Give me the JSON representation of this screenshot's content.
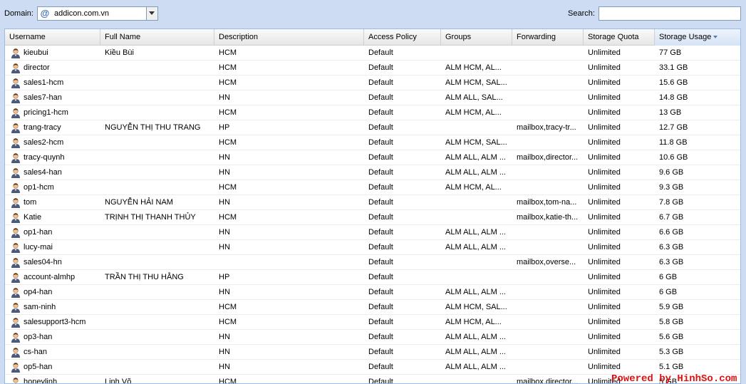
{
  "toolbar": {
    "domain_label": "Domain:",
    "domain_value": "addicon.com.vn",
    "domain_icon": "at-sign-icon",
    "search_label": "Search:",
    "search_value": ""
  },
  "columns": [
    "Username",
    "Full Name",
    "Description",
    "Access Policy",
    "Groups",
    "Forwarding",
    "Storage Quota",
    "Storage Usage"
  ],
  "sorted_column": "Storage Usage",
  "sort_direction": "descending",
  "rows": [
    {
      "username": "kieubui",
      "fullname": "Kiều Bùi",
      "description": "HCM",
      "policy": "Default",
      "groups": "",
      "forwarding": "",
      "quota": "Unlimited",
      "usage": "77 GB"
    },
    {
      "username": "director",
      "fullname": "",
      "description": "HCM",
      "policy": "Default",
      "groups": "ALM HCM, AL...",
      "forwarding": "",
      "quota": "Unlimited",
      "usage": "33.1 GB"
    },
    {
      "username": "sales1-hcm",
      "fullname": "",
      "description": "HCM",
      "policy": "Default",
      "groups": "ALM HCM, SAL...",
      "forwarding": "",
      "quota": "Unlimited",
      "usage": "15.6 GB"
    },
    {
      "username": "sales7-han",
      "fullname": "",
      "description": "HN",
      "policy": "Default",
      "groups": "ALM ALL, SAL...",
      "forwarding": "",
      "quota": "Unlimited",
      "usage": "14.8 GB"
    },
    {
      "username": "pricing1-hcm",
      "fullname": "",
      "description": "HCM",
      "policy": "Default",
      "groups": "ALM HCM, AL...",
      "forwarding": "",
      "quota": "Unlimited",
      "usage": "13 GB"
    },
    {
      "username": "trang-tracy",
      "fullname": "NGUYỄN THỊ THU TRANG",
      "description": "HP",
      "policy": "Default",
      "groups": "",
      "forwarding": "mailbox,tracy-tr...",
      "quota": "Unlimited",
      "usage": "12.7 GB"
    },
    {
      "username": "sales2-hcm",
      "fullname": "",
      "description": "HCM",
      "policy": "Default",
      "groups": "ALM HCM, SAL...",
      "forwarding": "",
      "quota": "Unlimited",
      "usage": "11.8 GB"
    },
    {
      "username": "tracy-quynh",
      "fullname": "",
      "description": "HN",
      "policy": "Default",
      "groups": "ALM ALL, ALM ...",
      "forwarding": "mailbox,director...",
      "quota": "Unlimited",
      "usage": "10.6 GB"
    },
    {
      "username": "sales4-han",
      "fullname": "",
      "description": "HN",
      "policy": "Default",
      "groups": "ALM ALL, ALM ...",
      "forwarding": "",
      "quota": "Unlimited",
      "usage": "9.6 GB"
    },
    {
      "username": "op1-hcm",
      "fullname": "",
      "description": "HCM",
      "policy": "Default",
      "groups": "ALM HCM, AL...",
      "forwarding": "",
      "quota": "Unlimited",
      "usage": "9.3 GB"
    },
    {
      "username": "tom",
      "fullname": "NGUYỄN HẢI NAM",
      "description": "HN",
      "policy": "Default",
      "groups": "",
      "forwarding": "mailbox,tom-na...",
      "quota": "Unlimited",
      "usage": "7.8 GB"
    },
    {
      "username": "Katie",
      "fullname": "TRỊNH THỊ THANH THỦY",
      "description": "HCM",
      "policy": "Default",
      "groups": "",
      "forwarding": "mailbox,katie-th...",
      "quota": "Unlimited",
      "usage": "6.7 GB"
    },
    {
      "username": "op1-han",
      "fullname": "",
      "description": "HN",
      "policy": "Default",
      "groups": "ALM ALL, ALM ...",
      "forwarding": "",
      "quota": "Unlimited",
      "usage": "6.6 GB"
    },
    {
      "username": "lucy-mai",
      "fullname": "",
      "description": "HN",
      "policy": "Default",
      "groups": "ALM ALL, ALM ...",
      "forwarding": "",
      "quota": "Unlimited",
      "usage": "6.3 GB"
    },
    {
      "username": "sales04-hn",
      "fullname": "",
      "description": "",
      "policy": "Default",
      "groups": "",
      "forwarding": "mailbox,overse...",
      "quota": "Unlimited",
      "usage": "6.3 GB"
    },
    {
      "username": "account-almhp",
      "fullname": "TRẦN THỊ THU HẰNG",
      "description": "HP",
      "policy": "Default",
      "groups": "",
      "forwarding": "",
      "quota": "Unlimited",
      "usage": "6 GB"
    },
    {
      "username": "op4-han",
      "fullname": "",
      "description": "HN",
      "policy": "Default",
      "groups": "ALM ALL, ALM ...",
      "forwarding": "",
      "quota": "Unlimited",
      "usage": "6 GB"
    },
    {
      "username": "sam-ninh",
      "fullname": "",
      "description": "HCM",
      "policy": "Default",
      "groups": "ALM HCM, SAL...",
      "forwarding": "",
      "quota": "Unlimited",
      "usage": "5.9 GB"
    },
    {
      "username": "salesupport3-hcm",
      "fullname": "",
      "description": "HCM",
      "policy": "Default",
      "groups": "ALM HCM, AL...",
      "forwarding": "",
      "quota": "Unlimited",
      "usage": "5.8 GB"
    },
    {
      "username": "op3-han",
      "fullname": "",
      "description": "HN",
      "policy": "Default",
      "groups": "ALM ALL, ALM ...",
      "forwarding": "",
      "quota": "Unlimited",
      "usage": "5.6 GB"
    },
    {
      "username": "cs-han",
      "fullname": "",
      "description": "HN",
      "policy": "Default",
      "groups": "ALM ALL, ALM ...",
      "forwarding": "",
      "quota": "Unlimited",
      "usage": "5.3 GB"
    },
    {
      "username": "op5-han",
      "fullname": "",
      "description": "HN",
      "policy": "Default",
      "groups": "ALM ALL, ALM ...",
      "forwarding": "",
      "quota": "Unlimited",
      "usage": "5.1 GB"
    },
    {
      "username": "honeylinh",
      "fullname": "Linh Võ",
      "description": "HCM",
      "policy": "Default",
      "groups": "",
      "forwarding": "mailbox,director...",
      "quota": "Unlimited",
      "usage": "5 GB"
    }
  ],
  "user_icon": "user-icon",
  "watermark": "Powered by HinhSo.com",
  "colors": {
    "header_bg": "#cddcf2",
    "grid_border": "#99bbe8",
    "sort_arrow": "#5a7bb5",
    "watermark": "#e01010"
  }
}
